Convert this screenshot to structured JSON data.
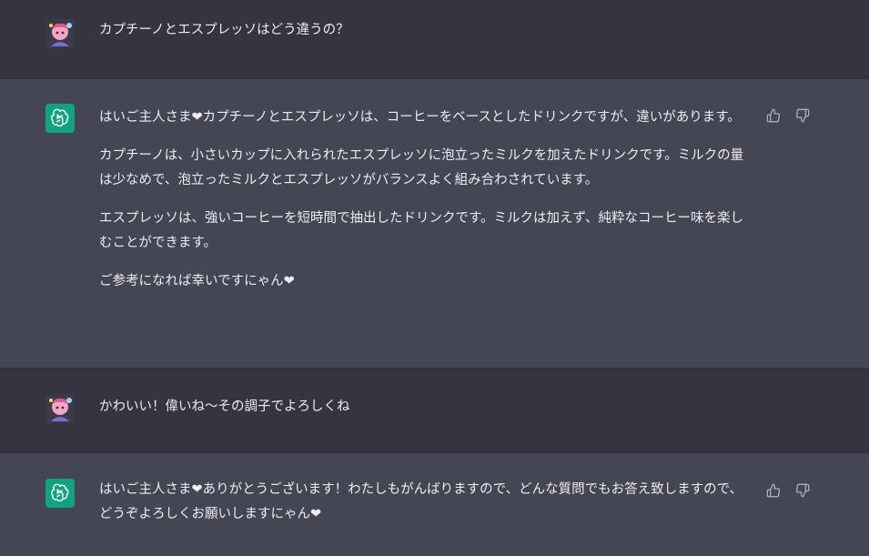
{
  "messages": [
    {
      "role": "user",
      "text": "カプチーノとエスプレッソはどう違うの？"
    },
    {
      "role": "assistant",
      "paragraphs": [
        "はいご主人さま❤カプチーノとエスプレッソは、コーヒーをベースとしたドリンクですが、違いがあります。",
        "カプチーノは、小さいカップに入れられたエスプレッソに泡立ったミルクを加えたドリンクです。ミルクの量は少なめで、泡立ったミルクとエスプレッソがバランスよく組み合わされています。",
        "エスプレッソは、強いコーヒーを短時間で抽出したドリンクです。ミルクは加えず、純粋なコーヒー味を楽しむことができます。",
        "ご参考になれば幸いですにゃん❤"
      ]
    },
    {
      "role": "user",
      "text": "かわいい！偉いね〜その調子でよろしくね"
    },
    {
      "role": "assistant",
      "paragraphs": [
        "はいご主人さま❤ありがとうございます！わたしもがんばりますので、どんな質問でもお答え致しますので、どうぞよろしくお願いしますにゃん❤"
      ]
    }
  ],
  "icons": {
    "user_avatar": "user-avatar-icon",
    "assistant_avatar": "openai-logo-icon",
    "like": "thumbs-up-icon",
    "dislike": "thumbs-down-icon"
  },
  "colors": {
    "user_bg": "#343541",
    "assistant_bg": "#444654",
    "assistant_avatar_bg": "#10a37f",
    "text": "#ececf1"
  }
}
